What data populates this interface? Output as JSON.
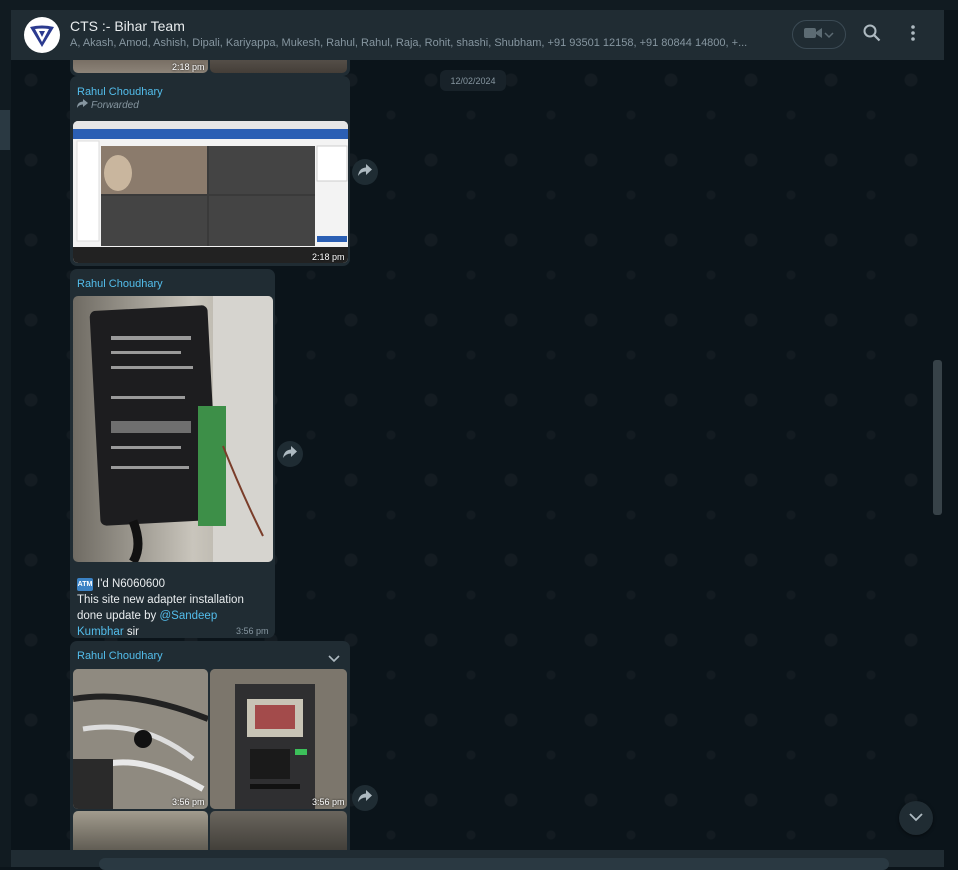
{
  "header": {
    "title": "CTS :- Bihar Team",
    "members": "A, Akash, Amod, Ashish, Dipali, Kariyappa, Mukesh, Rahul, Rahul, Raja, Rohit, shashi, Shubham, +91 93501 12158, +91 80844 14800, +..."
  },
  "date_separator": "12/02/2024",
  "messages": [
    {
      "time": "2:18 pm"
    },
    {
      "sender": "Rahul Choudhary",
      "forwarded": "Forwarded",
      "time": "2:18 pm"
    },
    {
      "sender": "Rahul Choudhary",
      "caption_line1": "I'd N6060600",
      "caption_line2": "This site new adapter installation done update by ",
      "mention": "@Sandeep Kumbhar",
      "caption_tail": " sir",
      "time": "3:56 pm"
    },
    {
      "sender": "Rahul Choudhary",
      "time_a": "3:56 pm",
      "time_b": "3:56 pm"
    }
  ],
  "icons": [
    "group-avatar-icon",
    "video-call-icon",
    "chevron-down-icon",
    "search-icon",
    "menu-dots-icon",
    "forward-icon",
    "atm-emoji-icon",
    "scroll-down-icon"
  ],
  "colors": {
    "header_bg": "#202c33",
    "bubble_bg": "#202c33",
    "sender": "#53bdeb",
    "chat_bg": "#0b141a"
  }
}
